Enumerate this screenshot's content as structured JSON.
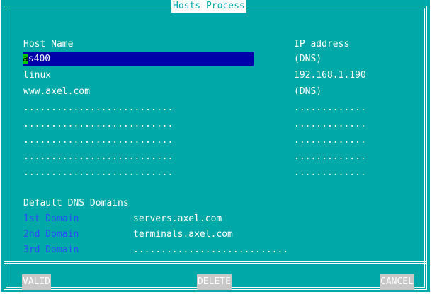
{
  "window": {
    "title": "Hosts Process"
  },
  "columns": {
    "host_name": "Host Name",
    "ip_address": "IP address"
  },
  "hosts": [
    {
      "name_rest": "s400",
      "name_cursor": "a",
      "ip": "(DNS)"
    },
    {
      "name": "linux",
      "ip": "192.168.1.190"
    },
    {
      "name": "www.axel.com",
      "ip": "(DNS)"
    },
    {
      "name": "...........................",
      "ip": "............."
    },
    {
      "name": "...........................",
      "ip": "............."
    },
    {
      "name": "...........................",
      "ip": "............."
    },
    {
      "name": "...........................",
      "ip": "............."
    },
    {
      "name": "...........................",
      "ip": "............."
    }
  ],
  "dns": {
    "section_title": "Default DNS Domains",
    "domains": [
      {
        "label": "1st Domain",
        "value": "servers.axel.com"
      },
      {
        "label": "2nd Domain",
        "value": "terminals.axel.com"
      },
      {
        "label": "3rd Domain",
        "value": "............................"
      }
    ]
  },
  "buttons": {
    "valid": "VALID",
    "delete": "DELETE",
    "cancel": "CANCEL"
  },
  "colors": {
    "background": "#00a8a8",
    "selected_field": "#0000aa",
    "cursor": "#00cc00",
    "domain_label": "#2a4cff",
    "button": "#c8c8c8"
  }
}
